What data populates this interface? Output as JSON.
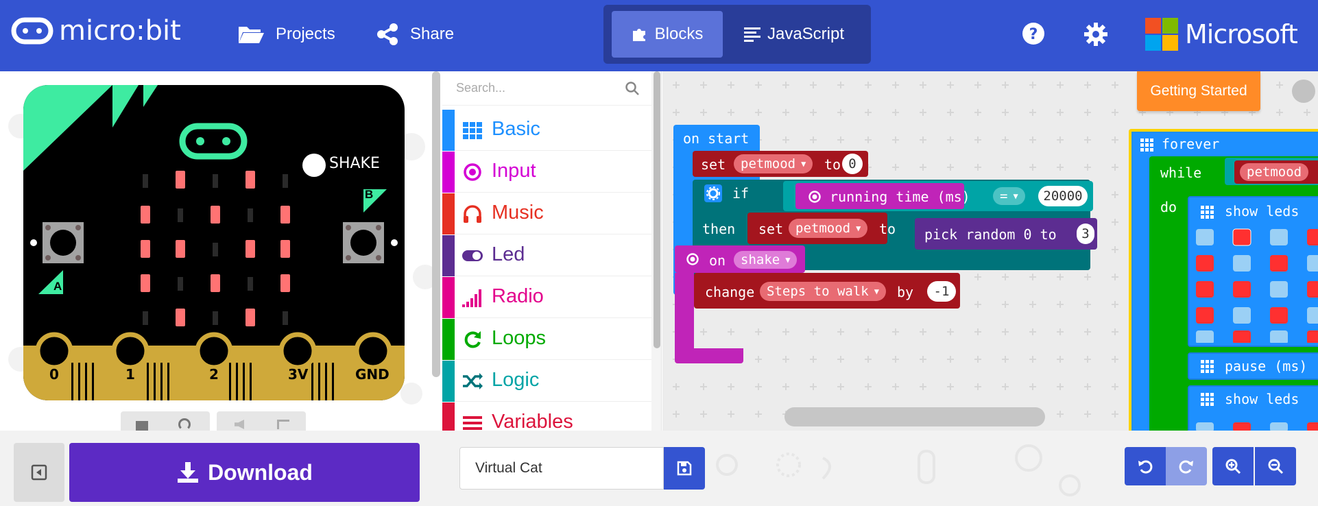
{
  "header": {
    "logo_text": "micro:bit",
    "projects_label": "Projects",
    "share_label": "Share",
    "blocks_label": "Blocks",
    "javascript_label": "JavaScript",
    "microsoft_label": "Microsoft",
    "colors": {
      "bar": "#3454d1",
      "toggle": "#293d99",
      "toggle_active": "#5b72d9"
    }
  },
  "simulator": {
    "shake_label": "SHAKE",
    "button_a": "A",
    "button_b": "B",
    "pins": [
      "0",
      "1",
      "2",
      "3V",
      "GND"
    ]
  },
  "toolbox": {
    "search_placeholder": "Search...",
    "categories": [
      {
        "label": "Basic",
        "color": "#1e90ff",
        "icon": "grid-icon"
      },
      {
        "label": "Input",
        "color": "#d400d4",
        "icon": "radio-button-icon"
      },
      {
        "label": "Music",
        "color": "#e63022",
        "icon": "headphones-icon"
      },
      {
        "label": "Led",
        "color": "#5c2d91",
        "icon": "toggle-icon"
      },
      {
        "label": "Radio",
        "color": "#e3008c",
        "icon": "signal-bars-icon"
      },
      {
        "label": "Loops",
        "color": "#00aa00",
        "icon": "loop-arrow-icon"
      },
      {
        "label": "Logic",
        "color": "#00a4a6",
        "icon": "shuffle-icon"
      },
      {
        "label": "Variables",
        "color": "#dc143c",
        "icon": "lines-icon"
      }
    ]
  },
  "workspace": {
    "getting_started": "Getting Started",
    "on_start": "on start",
    "set_kw": "set",
    "to_kw": "to",
    "petmood_var": "petmood",
    "initial_value": "0",
    "if_kw": "if",
    "then_kw": "then",
    "running_time": "running time (ms)",
    "equals_op": "=",
    "compare_value": "20000",
    "pick_random": "pick random 0 to",
    "random_max": "3",
    "on_kw": "on",
    "shake_event": "shake",
    "change_kw": "change",
    "steps_var": "Steps to walk",
    "by_kw": "by",
    "change_value": "-1",
    "forever": "forever",
    "while_kw": "while",
    "do_kw": "do",
    "show_leds_1": "show leds",
    "pause_ms": "pause (ms)",
    "show_leds_2": "show leds"
  },
  "footer": {
    "download_label": "Download",
    "project_name": "Virtual Cat"
  }
}
